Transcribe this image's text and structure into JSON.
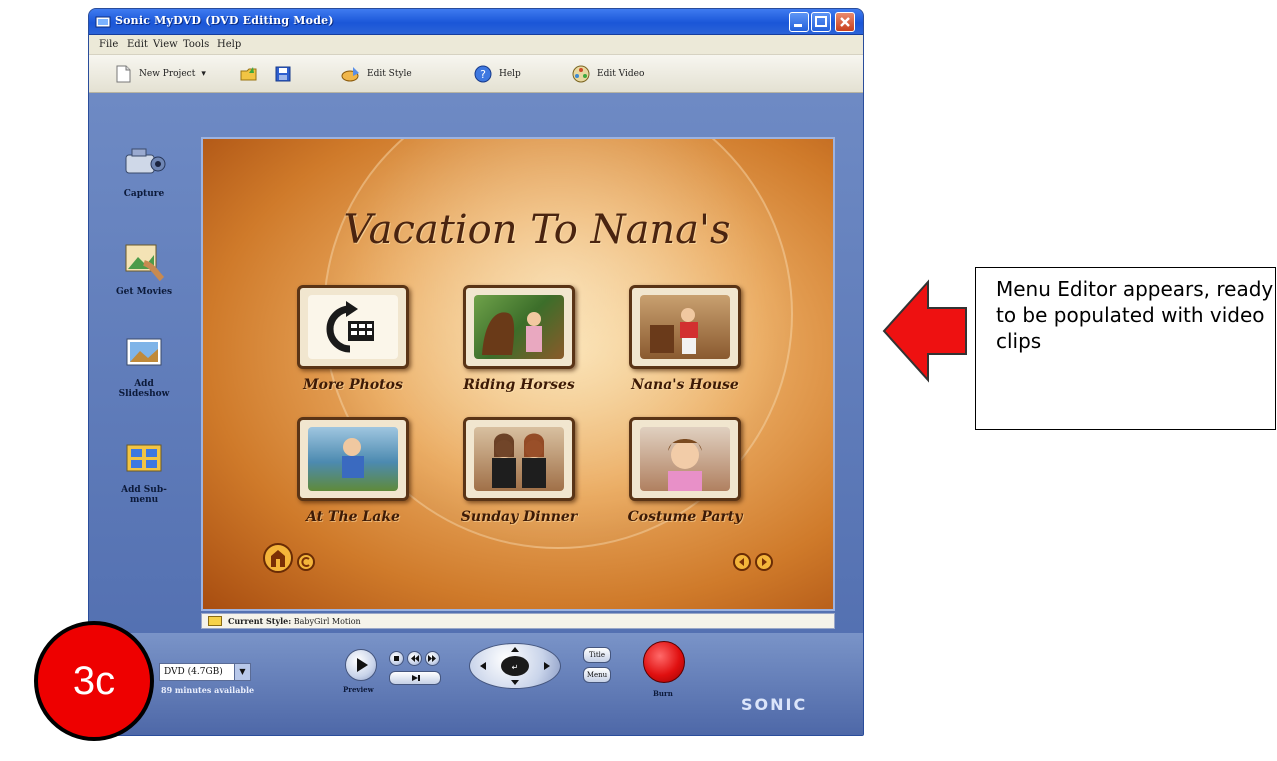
{
  "window": {
    "title": "Sonic MyDVD (DVD Editing Mode)"
  },
  "menubar": {
    "items": [
      "File",
      "Edit",
      "View",
      "Tools",
      "Help"
    ]
  },
  "toolbar": {
    "new_project": "New Project",
    "edit_style": "Edit Style",
    "help": "Help",
    "edit_video": "Edit Video"
  },
  "left_panel": {
    "capture": "Capture",
    "get_movies": "Get Movies",
    "add_slideshow": "Add Slideshow",
    "add_submenu": "Add Sub-menu"
  },
  "menu_editor": {
    "title": "Vacation To Nana's",
    "buttons": [
      {
        "label": "More Photos"
      },
      {
        "label": "Riding Horses"
      },
      {
        "label": "Nana's House"
      },
      {
        "label": "At The Lake"
      },
      {
        "label": "Sunday Dinner"
      },
      {
        "label": "Costume Party"
      }
    ]
  },
  "status": {
    "label": "Current Style:",
    "value": "BabyGirl Motion"
  },
  "bottom": {
    "disc": "DVD (4.7GB)",
    "minutes": "89 minutes available",
    "preview": "Preview",
    "title_btn": "Title",
    "menu_btn": "Menu",
    "burn": "Burn",
    "logo": "SONIC"
  },
  "callout": {
    "text": "Menu Editor appears, ready to be populated with video clips"
  },
  "step": {
    "label": "3c"
  },
  "colors": {
    "titlebar": "#1a56d8",
    "window_frame": "#5b79b8",
    "menu_background": "#cf7a2a",
    "arrow": "#ee1111",
    "burn_button": "#e01010",
    "badge": "#ee0000"
  }
}
